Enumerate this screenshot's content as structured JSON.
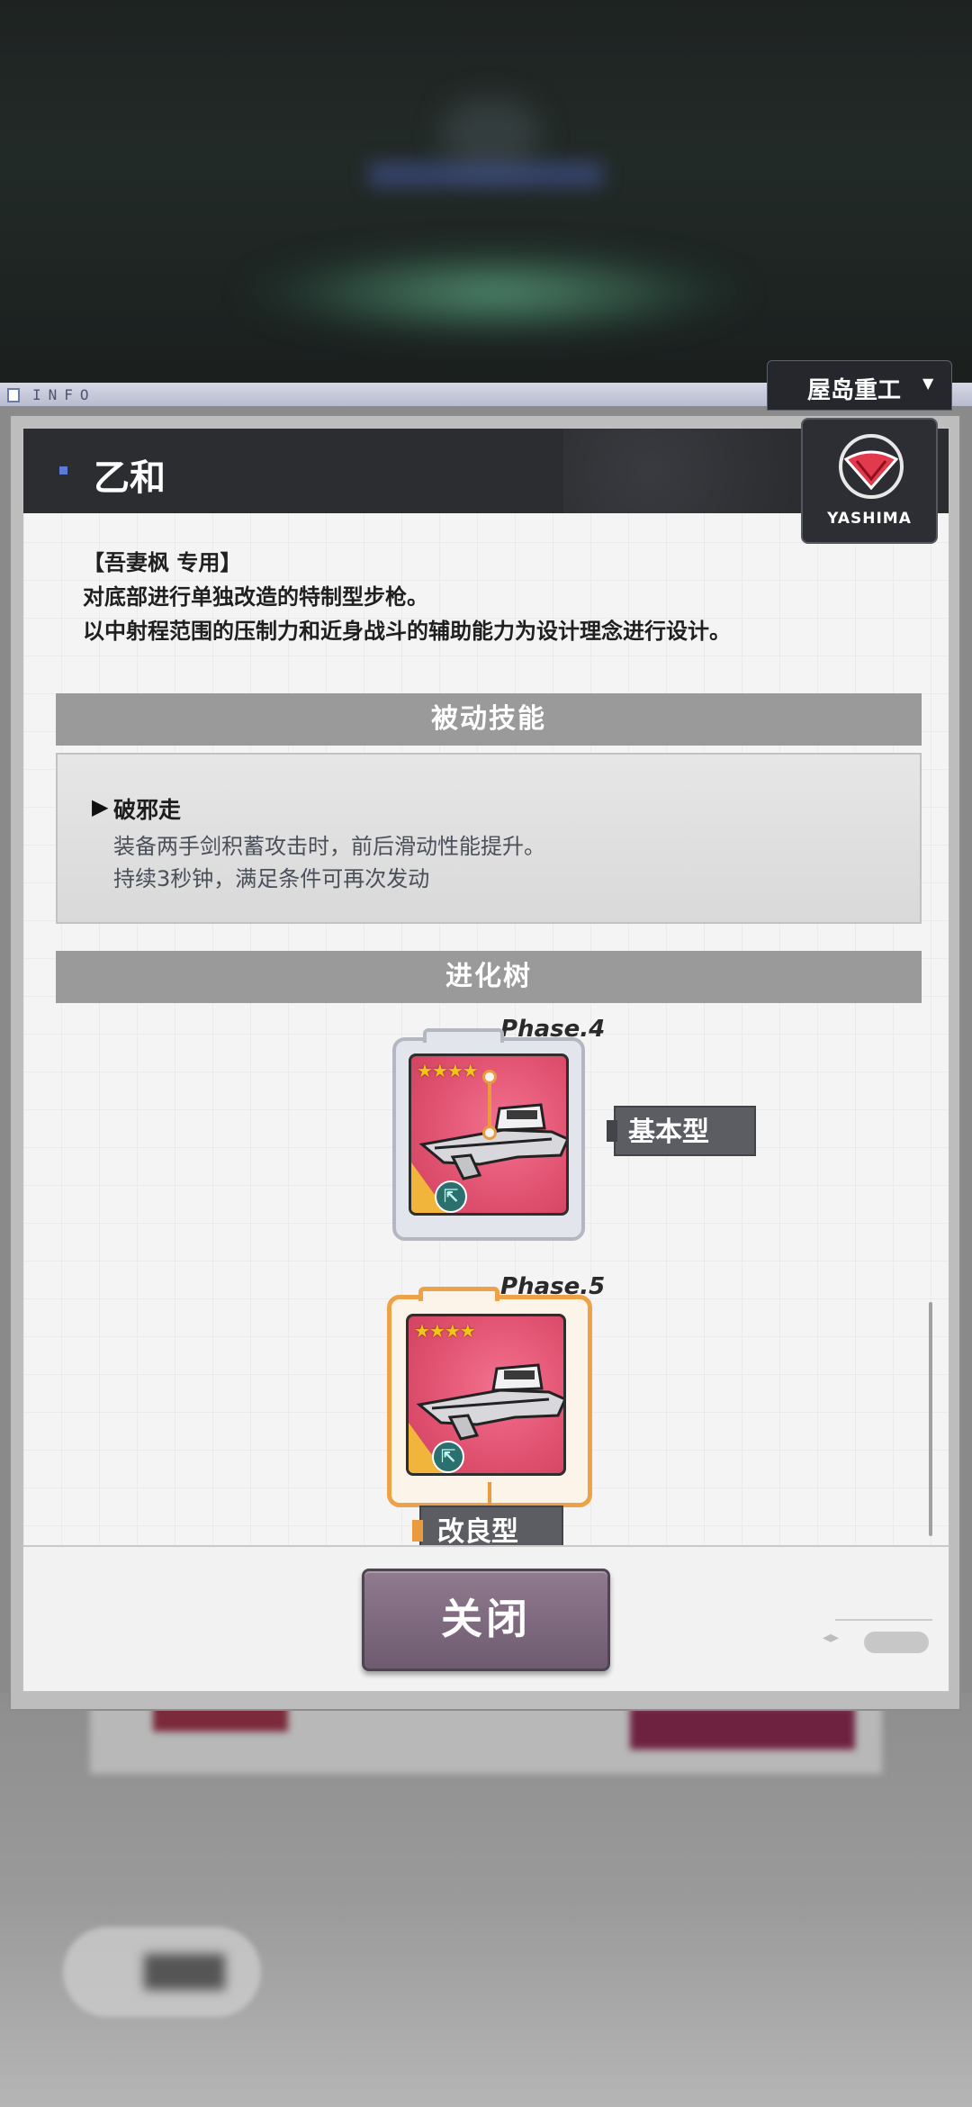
{
  "info_strip": {
    "label": "INFO"
  },
  "maker_dropdown": {
    "label": "屋岛重工",
    "arrow": "▼"
  },
  "logo": {
    "text": "YASHIMA"
  },
  "header": {
    "title": "乙和"
  },
  "description": [
    "【吾妻枫 专用】",
    "对底部进行单独改造的特制型步枪。",
    "以中射程范围的压制力和近身战斗的辅助能力为设计理念进行设计。"
  ],
  "passive": {
    "section_title": "被动技能",
    "skill_name": "破邪走",
    "lines": [
      "装备两手剑积蓄攻击时，前后滑动性能提升。",
      "持续3秒钟，满足条件可再次发动"
    ]
  },
  "evolution": {
    "section_title": "进化树",
    "phases": [
      {
        "phase_label": "Phase.4",
        "stars": "★★★★",
        "name": "基本型"
      },
      {
        "phase_label": "Phase.5",
        "stars": "★★★★",
        "name": "改良型"
      }
    ]
  },
  "footer": {
    "close_label": "关闭"
  },
  "colors": {
    "header_bg": "#2b2d31",
    "section_bar": "#9a9a9a",
    "close_button": "#7e6a7f",
    "phase5_frame": "#eea248",
    "card_bg": "#e0506f"
  }
}
